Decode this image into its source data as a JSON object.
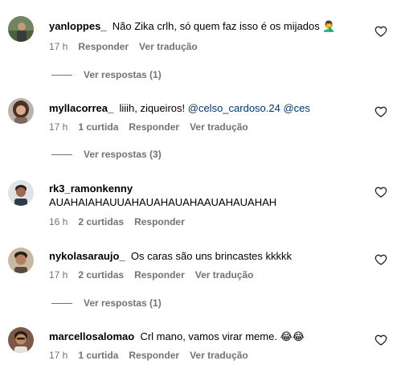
{
  "labels": {
    "reply": "Responder",
    "translate": "Ver tradução"
  },
  "comments": [
    {
      "username": "yanloppes_",
      "text": "Não Zika crlh, só quem faz isso é os mijados",
      "emoji": "🤦‍♂️",
      "time": "17 h",
      "likes": "",
      "replies_label": "Ver respostas (1)"
    },
    {
      "username": "myllacorrea_",
      "text": "liiih, ziqueiros!",
      "mentions": "@celso_cardoso.24 @ces",
      "time": "17 h",
      "likes": "1 curtida",
      "replies_label": "Ver respostas (3)"
    },
    {
      "username": "rk3_ramonkenny",
      "text": "AUAHAIAHAUUAHAUAHAUAHAAUAHAUAHAH",
      "time": "16 h",
      "likes": "2 curtidas"
    },
    {
      "username": "nykolasaraujo_",
      "text": "Os caras são uns brincastes kkkkk",
      "time": "17 h",
      "likes": "2 curtidas",
      "replies_label": "Ver respostas (1)"
    },
    {
      "username": "marcellosalomao",
      "text": "Crl mano, vamos virar meme.",
      "emoji": "😂😂",
      "time": "17 h",
      "likes": "1 curtida"
    }
  ],
  "colors": {
    "text": "#000000",
    "secondary": "#737373",
    "mention": "#00376b"
  },
  "icons": {
    "like": "heart-outline-icon"
  }
}
